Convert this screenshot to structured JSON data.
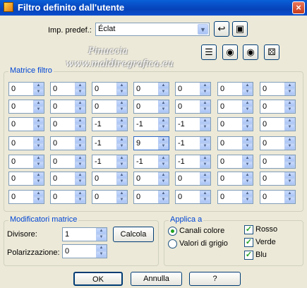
{
  "window": {
    "title": "Filtro definito dall'utente",
    "close_label": "×"
  },
  "preset": {
    "label": "Imp. predef.:",
    "value": "Éclat"
  },
  "watermark": {
    "line1": "Pinuccia",
    "line2": "www.maldiregrafica.eu"
  },
  "matrix": {
    "title": "Matrice filtro",
    "rows": [
      [
        "0",
        "0",
        "0",
        "0",
        "0",
        "0",
        "0"
      ],
      [
        "0",
        "0",
        "0",
        "0",
        "0",
        "0",
        "0"
      ],
      [
        "0",
        "0",
        "-1",
        "-1",
        "-1",
        "0",
        "0"
      ],
      [
        "0",
        "0",
        "-1",
        "9",
        "-1",
        "0",
        "0"
      ],
      [
        "0",
        "0",
        "-1",
        "-1",
        "-1",
        "0",
        "0"
      ],
      [
        "0",
        "0",
        "0",
        "0",
        "0",
        "0",
        "0"
      ],
      [
        "0",
        "0",
        "0",
        "0",
        "0",
        "0",
        "0"
      ]
    ]
  },
  "modifiers": {
    "title": "Modificatori matrice",
    "divisor_label": "Divisore:",
    "divisor_value": "1",
    "calc_label": "Calcola",
    "bias_label": "Polarizzazione:",
    "bias_value": "0"
  },
  "apply": {
    "title": "Applica a",
    "color_channels": "Canali colore",
    "gray_values": "Valori di grigio",
    "red": "Rosso",
    "green": "Verde",
    "blue": "Blu",
    "check_mark": "✓"
  },
  "buttons": {
    "ok": "OK",
    "cancel": "Annulla",
    "help": "?"
  }
}
